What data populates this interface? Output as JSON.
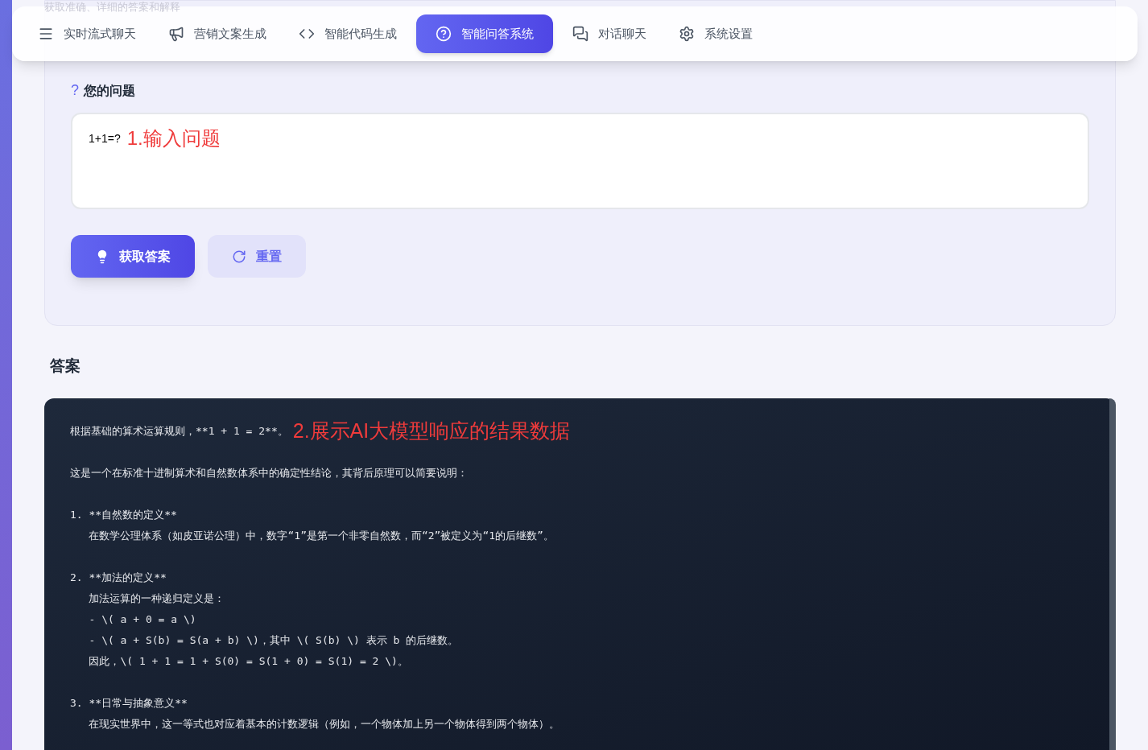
{
  "page_subtitle": "获取准确、详细的答案和解释",
  "tabs": [
    {
      "label": "实时流式聊天",
      "selected": false
    },
    {
      "label": "营销文案生成",
      "selected": false
    },
    {
      "label": "智能代码生成",
      "selected": false
    },
    {
      "label": "智能问答系统",
      "selected": true
    },
    {
      "label": "对话聊天",
      "selected": false
    },
    {
      "label": "系统设置",
      "selected": false
    }
  ],
  "question": {
    "mark": "?",
    "label": "您的问题",
    "value": "1+1=?",
    "annotation": "1.输入问题"
  },
  "buttons": [
    {
      "label": "获取答案",
      "kind": "primary"
    },
    {
      "label": "重置",
      "kind": "secondary"
    }
  ],
  "answer": {
    "heading": "答案",
    "annotation": "2.展示AI大模型响应的结果数据",
    "blocks": [
      [
        "根据基础的算术运算规则，**1 + 1 = 2**。"
      ],
      [
        "这是一个在标准十进制算术和自然数体系中的确定性结论，其背后原理可以简要说明："
      ],
      [
        "1. **自然数的定义**",
        "   在数学公理体系（如皮亚诺公理）中，数字“1”是第一个非零自然数，而“2”被定义为“1的后继数”。"
      ],
      [
        "2. **加法的定义**",
        "   加法运算的一种递归定义是：",
        "   - \\( a + 0 = a \\)",
        "   - \\( a + S(b) = S(a + b) \\)，其中 \\( S(b) \\) 表示 b 的后继数。",
        "   因此，\\( 1 + 1 = 1 + S(0) = S(1 + 0) = S(1) = 2 \\)。"
      ],
      [
        "3. **日常与抽象意义**",
        "   在现实世界中，这一等式也对应着基本的计数逻辑（例如，一个物体加上另一个物体得到两个物体）。"
      ]
    ]
  }
}
